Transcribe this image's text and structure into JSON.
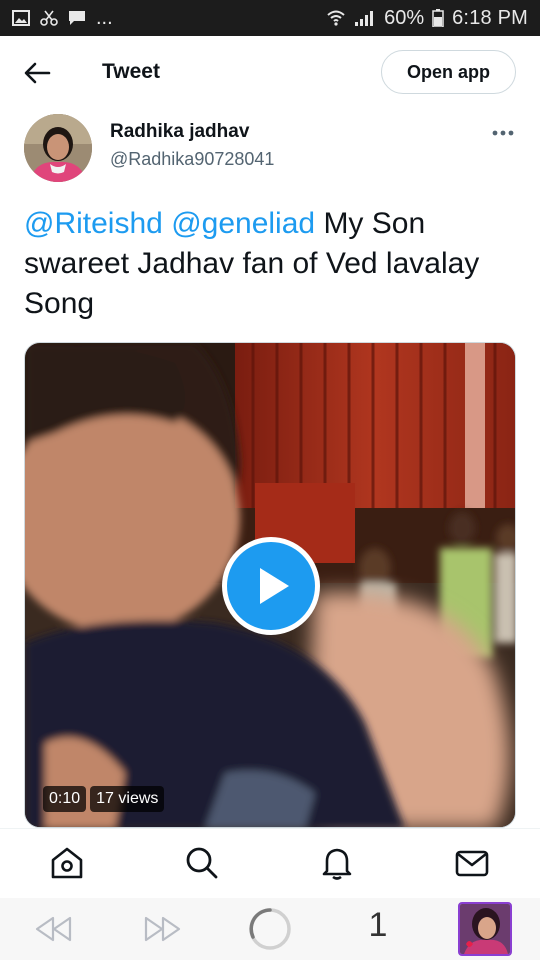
{
  "status_bar": {
    "dots": "...",
    "battery": "60%",
    "time": "6:18 PM"
  },
  "header": {
    "title": "Tweet",
    "open_app_label": "Open app"
  },
  "author": {
    "name": "Radhika jadhav",
    "handle": "@Radhika90728041"
  },
  "tweet": {
    "mention_1": "@Riteishd",
    "mention_2": "@geneliad",
    "text": "My Son swareet Jadhav fan of Ved lavalay Song"
  },
  "video": {
    "duration": "0:10",
    "views": "17 views"
  },
  "bottom_nav": {
    "items": [
      "home-icon",
      "search-icon",
      "notifications-icon",
      "messages-icon"
    ]
  },
  "browser_bar": {
    "tab_count": "1"
  },
  "colors": {
    "accent": "#1d9bf0",
    "text": "#0f1419",
    "secondary_text": "#536471"
  }
}
